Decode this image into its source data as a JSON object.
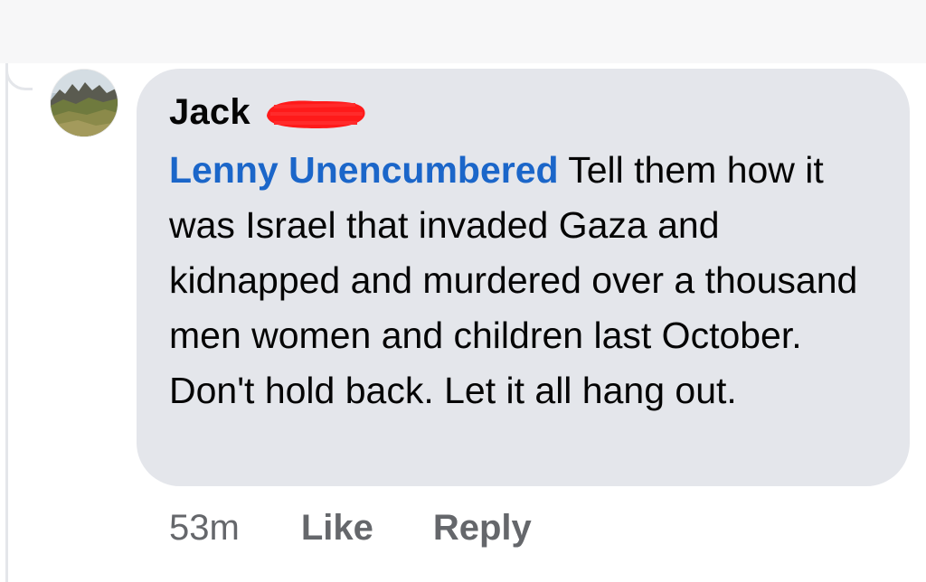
{
  "comment": {
    "author": "Jack",
    "mention": "Lenny Unencumbered",
    "body": " Tell them how it was Israel that invaded Gaza and kidnapped and murdered over a thousand men women and children last October. Don't hold back. Let it all hang out.",
    "timestamp": "53m",
    "like_label": "Like",
    "reply_label": "Reply"
  },
  "colors": {
    "bubble": "#e4e6eb",
    "mention": "#1b66c9",
    "meta_text": "#65676b",
    "redaction": "#ff1a1a"
  },
  "icons": {
    "avatar": "mountain-landscape-photo"
  }
}
